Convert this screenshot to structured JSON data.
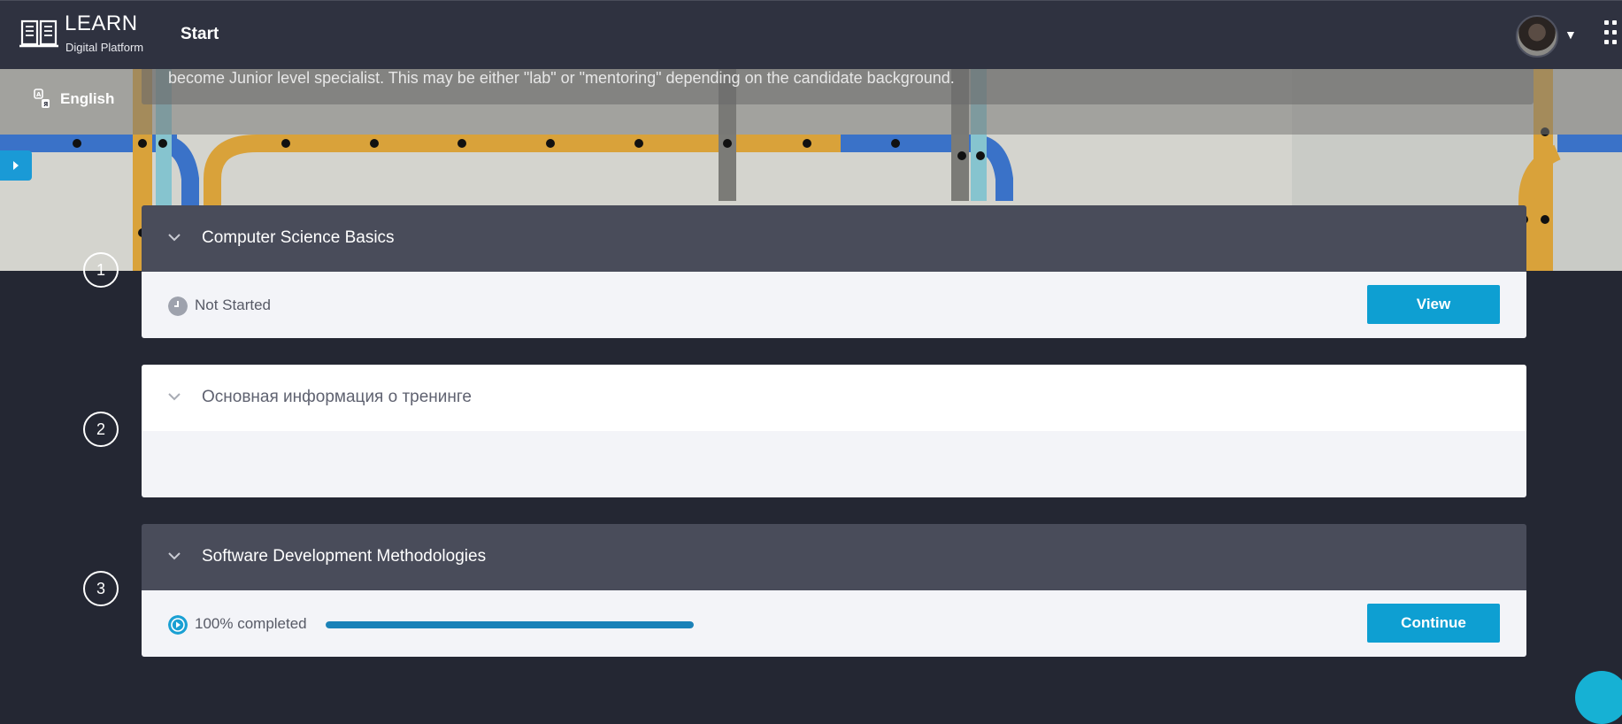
{
  "header": {
    "brand_title": "LEARN",
    "brand_subtitle": "Digital Platform",
    "nav_item": "Start",
    "icons": [
      "book-logo-icon",
      "user-avatar",
      "caret-down-icon",
      "apps-grid-icon"
    ]
  },
  "banner": {
    "description": "become Junior level specialist. This may be either \"lab\" or \"mentoring\" depending on the candidate background.",
    "language_label": "English"
  },
  "steps": [
    {
      "number": "1",
      "title": "Computer Science Basics",
      "status": "Not Started",
      "action": "View"
    },
    {
      "number": "2",
      "title": "Основная информация о тренинге"
    },
    {
      "number": "3",
      "title": "Software Development Methodologies",
      "status": "100% completed",
      "progress_percent": 100,
      "action": "Continue"
    }
  ],
  "colors": {
    "accent": "#0e9fd2",
    "progress": "#1b82b8",
    "navbar": "#2f3240",
    "card_header": "#494c5a",
    "background": "#242733"
  }
}
